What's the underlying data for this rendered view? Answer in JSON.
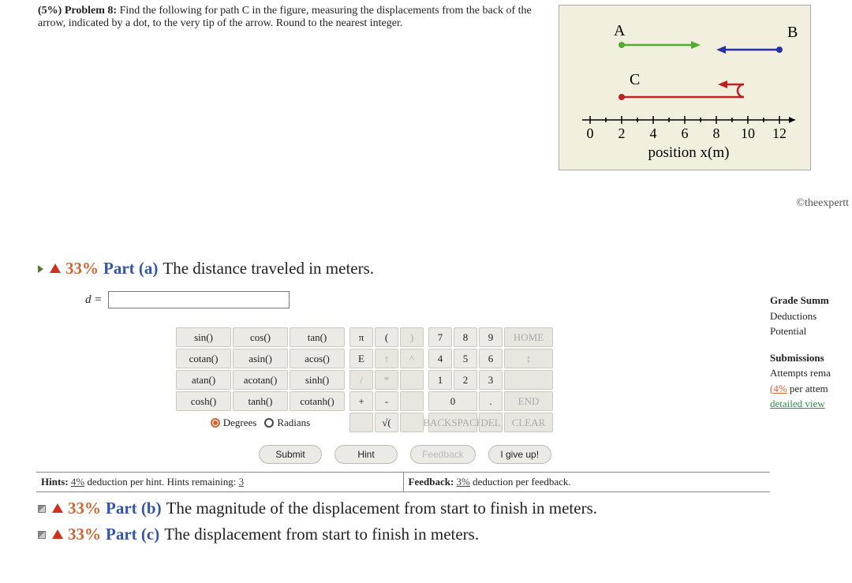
{
  "problem": {
    "header_bold": "(5%) Problem 8:",
    "header_text": "Find the following for path C in the figure, measuring the displacements from the back of the arrow, indicated by a dot, to the very tip of the arrow. Round to the nearest integer."
  },
  "figure": {
    "labels": {
      "A": "A",
      "B": "B",
      "C": "C"
    },
    "ticks": [
      "0",
      "2",
      "4",
      "6",
      "8",
      "10",
      "12"
    ],
    "xaxis": "position x(m)"
  },
  "copyright": "©theexpertt",
  "part_a": {
    "pct": "33%",
    "label": "Part (a)",
    "text": "The distance traveled in meters.",
    "lhs": "d =",
    "value": ""
  },
  "keypad": {
    "funcs": [
      [
        "sin()",
        "cos()",
        "tan()"
      ],
      [
        "cotan()",
        "asin()",
        "acos()"
      ],
      [
        "atan()",
        "acotan()",
        "sinh()"
      ],
      [
        "cosh()",
        "tanh()",
        "cotanh()"
      ]
    ],
    "deg": "Degrees",
    "rad": "Radians",
    "syms": [
      [
        "π",
        "(",
        ")"
      ],
      [
        "E",
        "↑",
        "^"
      ],
      [
        "/",
        "*",
        " "
      ],
      [
        "+",
        "-",
        " "
      ],
      [
        " ",
        "√(",
        " "
      ]
    ],
    "nums_r1": [
      "7",
      "8",
      "9",
      "HOME"
    ],
    "nums_r2": [
      "4",
      "5",
      "6",
      "↕"
    ],
    "nums_r3": [
      "1",
      "2",
      "3",
      " "
    ],
    "nums_r4": [
      "0",
      ".",
      "END"
    ],
    "nums_r5": [
      "BACKSPACE",
      "DEL",
      "CLEAR"
    ]
  },
  "actions": {
    "submit": "Submit",
    "hint": "Hint",
    "feedback": "Feedback",
    "giveup": "I give up!"
  },
  "hints": {
    "label": "Hints:",
    "pct": "4%",
    "text": "deduction per hint. Hints remaining:",
    "remain": "3"
  },
  "feedback": {
    "label": "Feedback:",
    "pct": "3%",
    "text": "deduction per feedback."
  },
  "grade": {
    "h1": "Grade Summ",
    "d": "Deductions",
    "p": "Potential",
    "h2": "Submissions",
    "a": "Attempts rema",
    "per": "per attem",
    "pct4": "(4%",
    "dv": "detailed view"
  },
  "part_b": {
    "pct": "33%",
    "label": "Part (b)",
    "text": "The magnitude of the displacement from start to finish in meters."
  },
  "part_c": {
    "pct": "33%",
    "label": "Part (c)",
    "text": "The displacement from start to finish in meters."
  },
  "chart_data": {
    "type": "diagram",
    "xaxis": "position x(m)",
    "xlim": [
      0,
      13
    ],
    "ticks": [
      0,
      2,
      4,
      6,
      8,
      10,
      12
    ],
    "paths": [
      {
        "name": "A",
        "color": "#55aa33",
        "start_x": 2,
        "end_x": 7,
        "y_row": 1
      },
      {
        "name": "B",
        "color": "#2233aa",
        "start_x": 12,
        "end_x": 8,
        "y_row": 1
      },
      {
        "name": "C",
        "color": "#bb2222",
        "start_x": 2,
        "end_x": 10,
        "then_back_to_x": 8,
        "y_row": 2
      }
    ]
  }
}
